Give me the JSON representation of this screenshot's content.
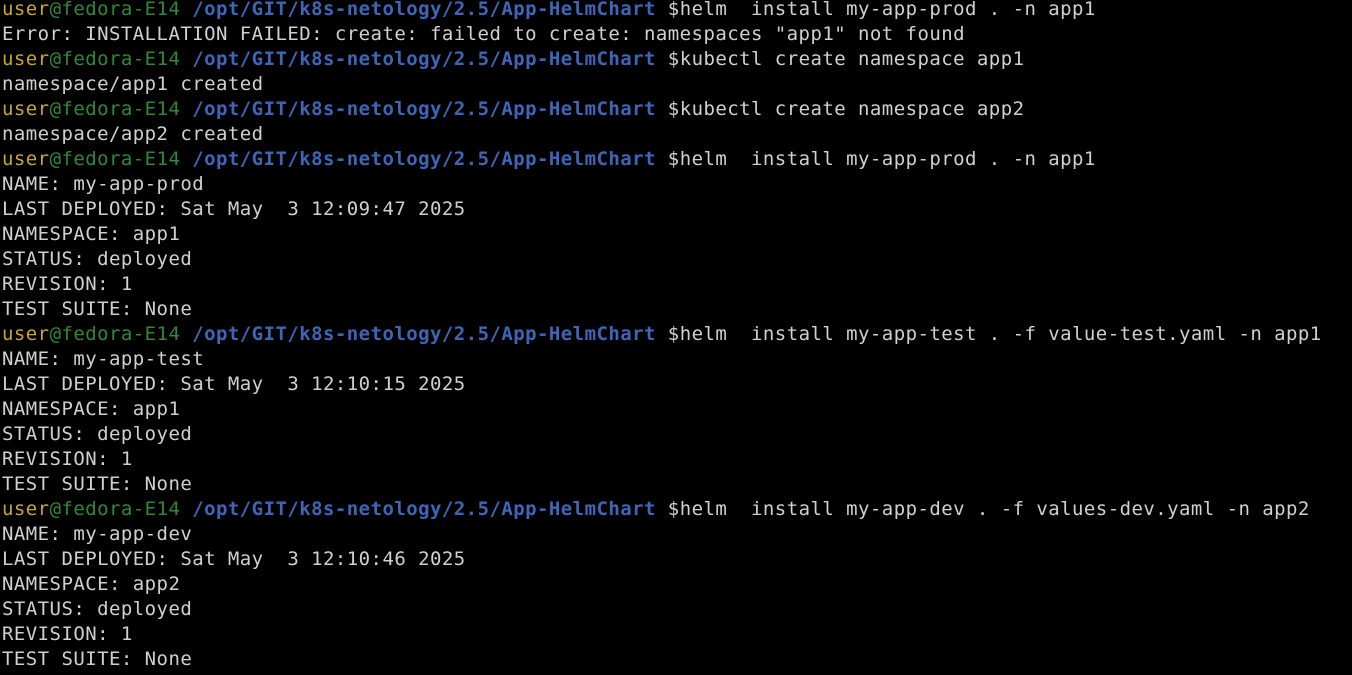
{
  "prompt": {
    "user": "user",
    "at_host": "@fedora-E14",
    "path": "/opt/GIT/k8s-netology/2.5/App-HelmChart",
    "dollar": "$"
  },
  "colors": {
    "background": "#000000",
    "user": "#c8a72a",
    "host": "#2e8a35",
    "path": "#3d66b8",
    "text": "#d0d0d0"
  },
  "lines": [
    {
      "type": "prompt",
      "command": "helm  install my-app-prod . -n app1"
    },
    {
      "type": "output",
      "text": "Error: INSTALLATION FAILED: create: failed to create: namespaces \"app1\" not found"
    },
    {
      "type": "prompt",
      "command": "kubectl create namespace app1"
    },
    {
      "type": "output",
      "text": "namespace/app1 created"
    },
    {
      "type": "prompt",
      "command": "kubectl create namespace app2"
    },
    {
      "type": "output",
      "text": "namespace/app2 created"
    },
    {
      "type": "prompt",
      "command": "helm  install my-app-prod . -n app1"
    },
    {
      "type": "output",
      "text": "NAME: my-app-prod"
    },
    {
      "type": "output",
      "text": "LAST DEPLOYED: Sat May  3 12:09:47 2025"
    },
    {
      "type": "output",
      "text": "NAMESPACE: app1"
    },
    {
      "type": "output",
      "text": "STATUS: deployed"
    },
    {
      "type": "output",
      "text": "REVISION: 1"
    },
    {
      "type": "output",
      "text": "TEST SUITE: None"
    },
    {
      "type": "prompt",
      "command": "helm  install my-app-test . -f value-test.yaml -n app1"
    },
    {
      "type": "output",
      "text": "NAME: my-app-test"
    },
    {
      "type": "output",
      "text": "LAST DEPLOYED: Sat May  3 12:10:15 2025"
    },
    {
      "type": "output",
      "text": "NAMESPACE: app1"
    },
    {
      "type": "output",
      "text": "STATUS: deployed"
    },
    {
      "type": "output",
      "text": "REVISION: 1"
    },
    {
      "type": "output",
      "text": "TEST SUITE: None"
    },
    {
      "type": "prompt",
      "command": "helm  install my-app-dev . -f values-dev.yaml -n app2"
    },
    {
      "type": "output",
      "text": "NAME: my-app-dev"
    },
    {
      "type": "output",
      "text": "LAST DEPLOYED: Sat May  3 12:10:46 2025"
    },
    {
      "type": "output",
      "text": "NAMESPACE: app2"
    },
    {
      "type": "output",
      "text": "STATUS: deployed"
    },
    {
      "type": "output",
      "text": "REVISION: 1"
    },
    {
      "type": "output",
      "text": "TEST SUITE: None"
    }
  ]
}
